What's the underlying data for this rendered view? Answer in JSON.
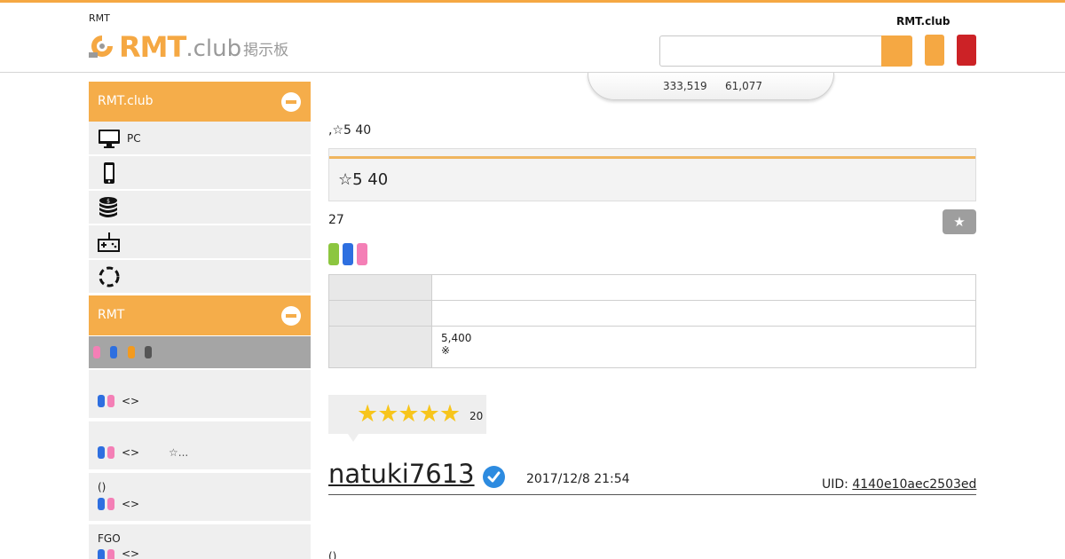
{
  "header": {
    "site_small": "RMT",
    "logo_rmt": "RMT",
    "logo_club": ".club",
    "logo_board": "掲示板",
    "site_right": "RMT.club",
    "search_placeholder": ""
  },
  "stats": {
    "value1": "333,519",
    "value2": "61,077"
  },
  "sidebar": {
    "section1_title": "RMT.club",
    "items": [
      {
        "icon": "monitor-icon",
        "label": "PC"
      },
      {
        "icon": "smartphone-icon",
        "label": ""
      },
      {
        "icon": "coin-stack-icon",
        "label": ""
      },
      {
        "icon": "game-controller-icon",
        "label": ""
      },
      {
        "icon": "dashed-circle-icon",
        "label": ""
      }
    ],
    "section2_title": "RMT",
    "tag_colors": [
      "#f47fb6",
      "#2e6fe0",
      "#f39a1e",
      "#555555"
    ],
    "threads": [
      {
        "line1": "",
        "line2": "<>",
        "line3": ""
      },
      {
        "line1": "",
        "line2": "<>",
        "line3": "☆..."
      },
      {
        "line1": "()",
        "line2": "<>",
        "line3": ""
      },
      {
        "line1": "FGO",
        "line2": "<>",
        "line3": ""
      }
    ]
  },
  "main": {
    "breadcrumb": ",☆5 40",
    "title": "☆5 40",
    "count": "27",
    "tag_colors": [
      "#8cc63f",
      "#2e6fe0",
      "#f47fb6"
    ],
    "table": [
      {
        "key": "",
        "value": ""
      },
      {
        "key": "",
        "value": ""
      },
      {
        "key": "",
        "value_line1": "5,400",
        "value_line2": "※"
      }
    ],
    "rating": {
      "stars": "★★★★★",
      "count": "20",
      "value": 5
    },
    "post": {
      "username": "natuki7613",
      "date": "2017/12/8 21:54",
      "uid_label": "UID:",
      "uid_value": "4140e10aec2503ed",
      "body_start": "()"
    }
  },
  "colors": {
    "accent": "#f5a843",
    "danger": "#cc2226",
    "star": "#f7c51c",
    "verified": "#2d8be0"
  }
}
